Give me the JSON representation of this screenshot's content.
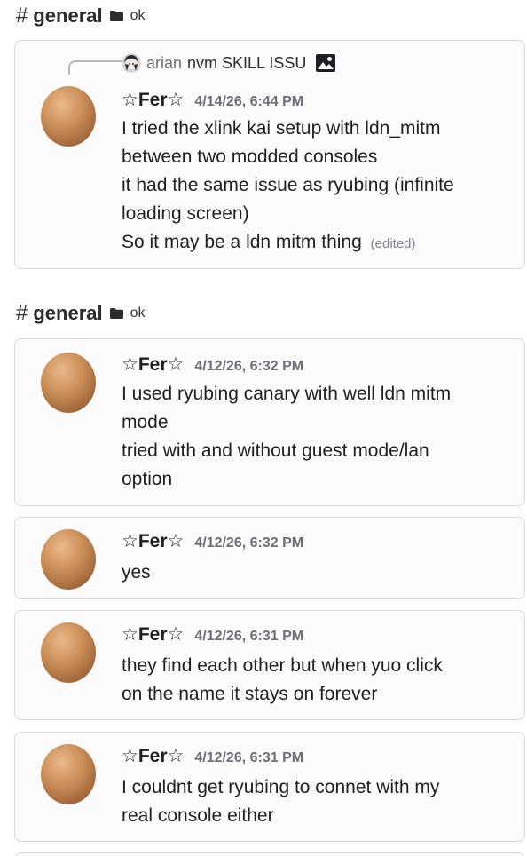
{
  "sections": [
    {
      "hash": "#",
      "channel": "general",
      "tag": "ok"
    },
    {
      "hash": "#",
      "channel": "general",
      "tag": "ok"
    }
  ],
  "reply": {
    "author": "arian",
    "text": "nvm SKILL ISSU"
  },
  "messages": [
    {
      "author": "☆Fer☆",
      "timestamp": "4/14/26, 6:44 PM",
      "lines": [
        "I tried the xlink kai setup with ldn_mitm",
        "between two modded consoles",
        "it had the same issue as ryubing (infinite",
        "loading screen)",
        "So it may be a ldn mitm thing"
      ],
      "edited_label": "(edited)"
    },
    {
      "author": "☆Fer☆",
      "timestamp": "4/12/26, 6:32 PM",
      "lines": [
        "I used ryubing canary with well ldn mitm",
        "mode",
        "tried with and without guest mode/lan",
        "option"
      ]
    },
    {
      "author": "☆Fer☆",
      "timestamp": "4/12/26, 6:32 PM",
      "lines": [
        "yes"
      ]
    },
    {
      "author": "☆Fer☆",
      "timestamp": "4/12/26, 6:31 PM",
      "lines": [
        "they find each other but when yuo click",
        "on the name it stays on forever"
      ]
    },
    {
      "author": "☆Fer☆",
      "timestamp": "4/12/26, 6:31 PM",
      "lines": [
        "I couldnt get ryubing to connet with my",
        "real console either"
      ]
    }
  ],
  "icons": {
    "channel": "hash-icon",
    "folder": "folder-icon",
    "avatar": "egg-avatar",
    "reply_avatar": "anime-avatar",
    "attachment": "image-icon"
  },
  "colors": {
    "avatar_egg": "#c98a54",
    "timestamp": "#6d6f78",
    "card_border": "#d9d9dc"
  }
}
